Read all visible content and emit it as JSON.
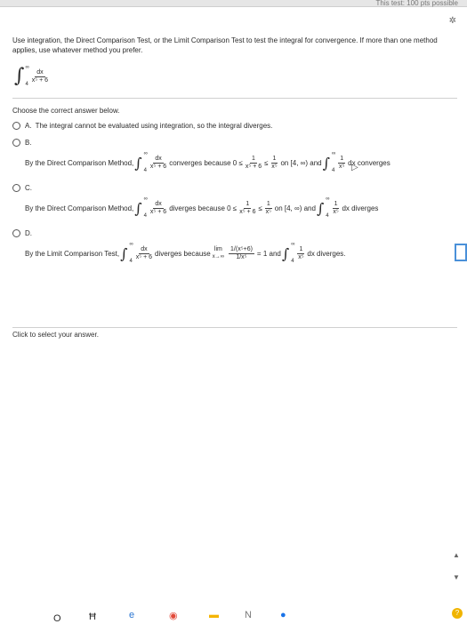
{
  "header": {
    "top_hint": "This test: 100 pts possible",
    "gear_icon": "gear-icon"
  },
  "question": {
    "text": "Use integration, the Direct Comparison Test, or the Limit Comparison Test to test the integral for convergence. If more than one method applies, use whatever method you prefer.",
    "integral": {
      "upper": "∞",
      "lower": "4",
      "numerator": "dx",
      "denominator": "x⁵ + 6"
    }
  },
  "instructions": "Choose the correct answer below.",
  "options": [
    {
      "letter": "A.",
      "text": "The integral cannot be evaluated using integration, so the integral diverges."
    },
    {
      "letter": "B.",
      "lead": "By the Direct Comparison Method,",
      "int_upper": "∞",
      "int_lower": "4",
      "int_num": "dx",
      "int_den": "x⁵ + 6",
      "mid": "converges because 0 ≤",
      "f1_num": "1",
      "f1_den": "x⁵ + 6",
      "le": "≤",
      "f2_num": "1",
      "f2_den": "x⁵",
      "tail1": "on [4, ∞) and",
      "int2_upper": "∞",
      "int2_lower": "4",
      "int2_num": "1",
      "int2_den": "x⁵",
      "tail2": "dx converges"
    },
    {
      "letter": "C.",
      "lead": "By the Direct Comparison Method,",
      "int_upper": "∞",
      "int_lower": "4",
      "int_num": "dx",
      "int_den": "x⁵ + 6",
      "mid": "diverges because 0 ≤",
      "f1_num": "1",
      "f1_den": "x⁵ + 6",
      "le": "≤",
      "f2_num": "1",
      "f2_den": "x⁵",
      "tail1": "on [4, ∞) and",
      "int2_upper": "∞",
      "int2_lower": "4",
      "int2_num": "1",
      "int2_den": "x⁵",
      "tail2": "dx diverges"
    },
    {
      "letter": "D.",
      "lead": "By the Limit Comparison Test,",
      "int_upper": "∞",
      "int_lower": "4",
      "int_num": "dx",
      "int_den": "x⁵ + 6",
      "mid": "diverges because",
      "lim_label": "lim",
      "lim_sub": "x→∞",
      "f1_num": "1/(x⁵+6)",
      "f1_den": "1/x⁵",
      "eq": "= 1 and",
      "int2_upper": "∞",
      "int2_lower": "4",
      "int2_num": "1",
      "int2_den": "x⁵",
      "tail2": "dx diverges."
    }
  ],
  "footer": {
    "text": "Click to select your answer."
  },
  "taskbar": {
    "items": [
      "O",
      "Ħ",
      "e",
      "chrome-icon",
      "folder-icon",
      "N",
      "store-icon"
    ]
  },
  "colors": {
    "help_icon": "#f0b400",
    "corner_box": "#4a90d9"
  }
}
